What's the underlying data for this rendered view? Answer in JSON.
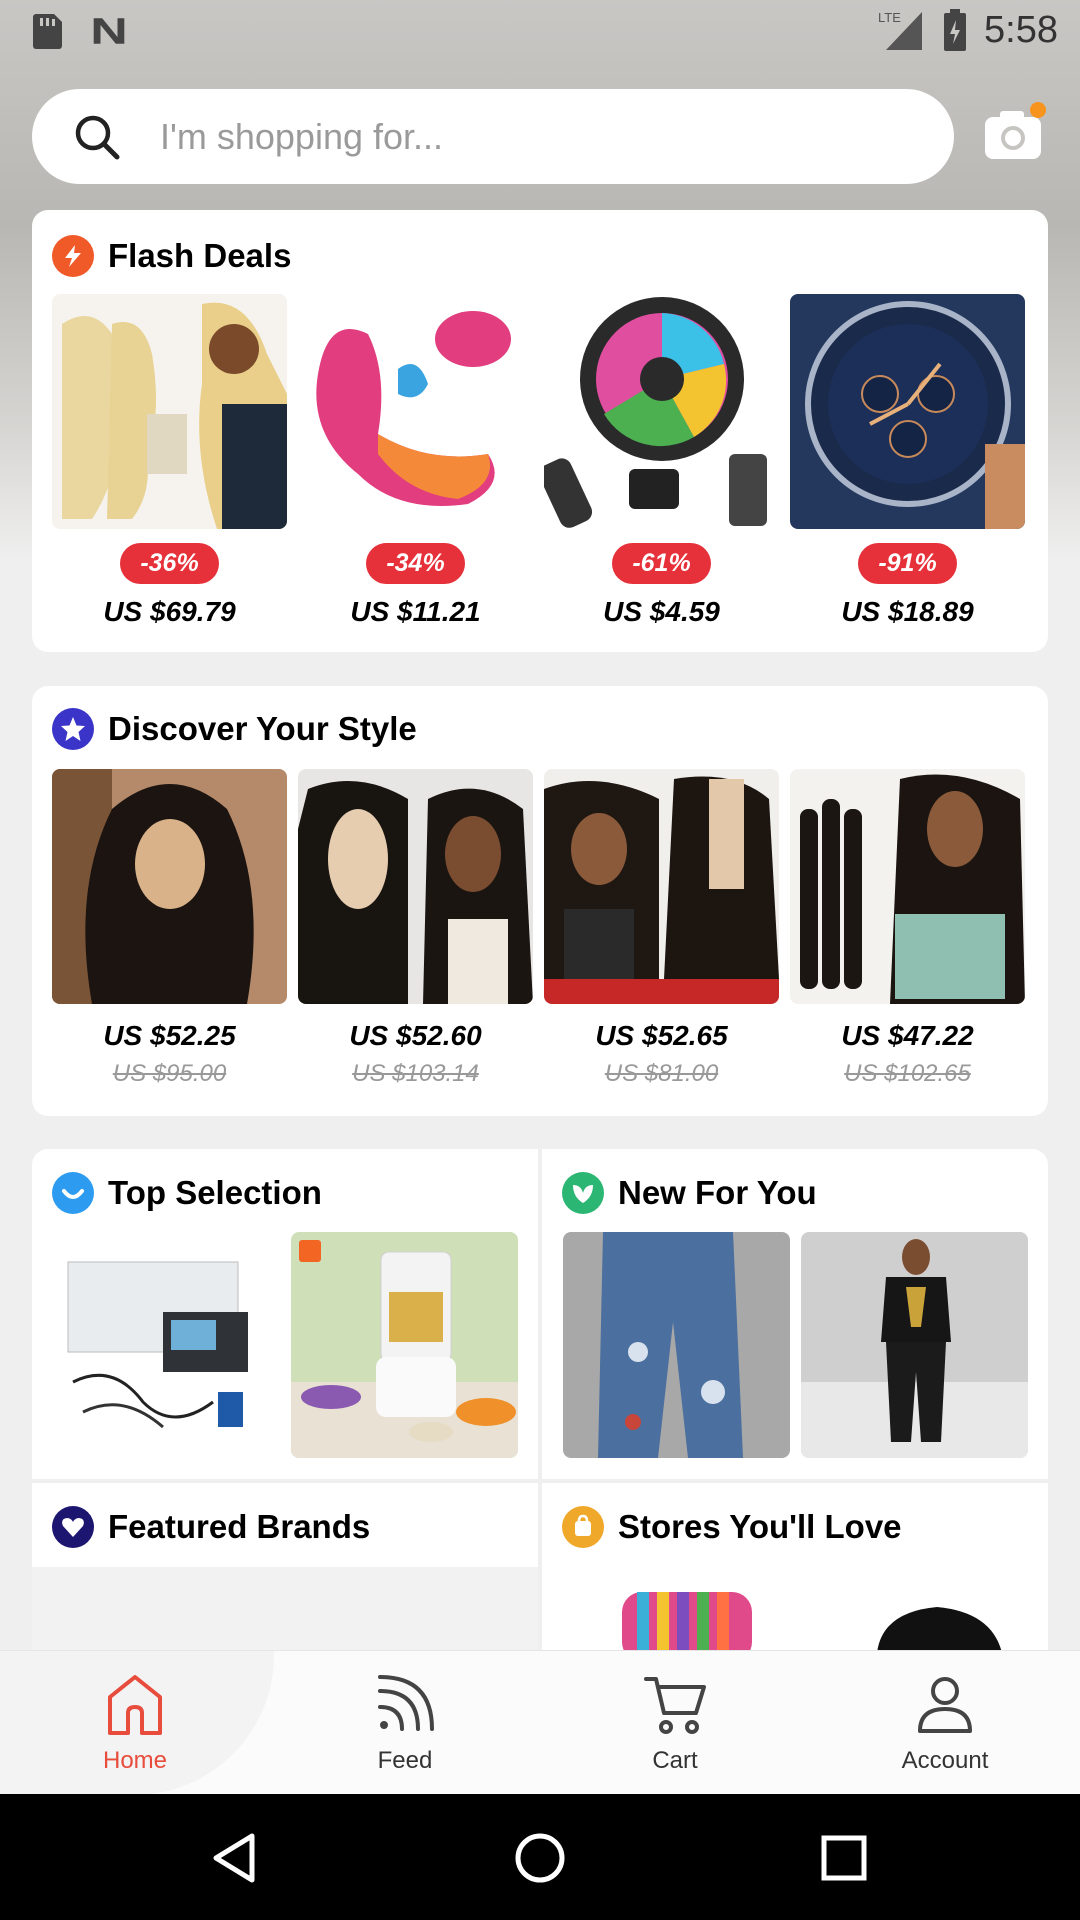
{
  "status_bar": {
    "time": "5:58",
    "network": "LTE"
  },
  "search": {
    "placeholder": "I'm shopping for..."
  },
  "flash_deals": {
    "title": "Flash Deals",
    "items": [
      {
        "discount": "-36%",
        "price": "US $69.79"
      },
      {
        "discount": "-34%",
        "price": "US $11.21"
      },
      {
        "discount": "-61%",
        "price": "US $4.59"
      },
      {
        "discount": "-91%",
        "price": "US $18.89"
      }
    ]
  },
  "discover": {
    "title": "Discover Your Style",
    "items": [
      {
        "price": "US $52.25",
        "old_price": "US $95.00"
      },
      {
        "price": "US $52.60",
        "old_price": "US $103.14"
      },
      {
        "price": "US $52.65",
        "old_price": "US $81.00"
      },
      {
        "price": "US $47.22",
        "old_price": "US $102.65"
      }
    ]
  },
  "sections": {
    "top_selection": "Top Selection",
    "new_for_you": "New For You",
    "featured_brands": "Featured Brands",
    "stores": "Stores You'll Love"
  },
  "bottom_nav": {
    "items": [
      {
        "label": "Home",
        "active": true
      },
      {
        "label": "Feed"
      },
      {
        "label": "Cart"
      },
      {
        "label": "Account"
      }
    ]
  },
  "colors": {
    "accent": "#e74c3c",
    "flash_icon": "#f05a28",
    "discover_icon": "#3a35c8",
    "top_sel_icon": "#2d9cf0",
    "new_icon": "#2bb673",
    "featured_icon": "#1d1670",
    "stores_icon": "#f0a82a"
  }
}
